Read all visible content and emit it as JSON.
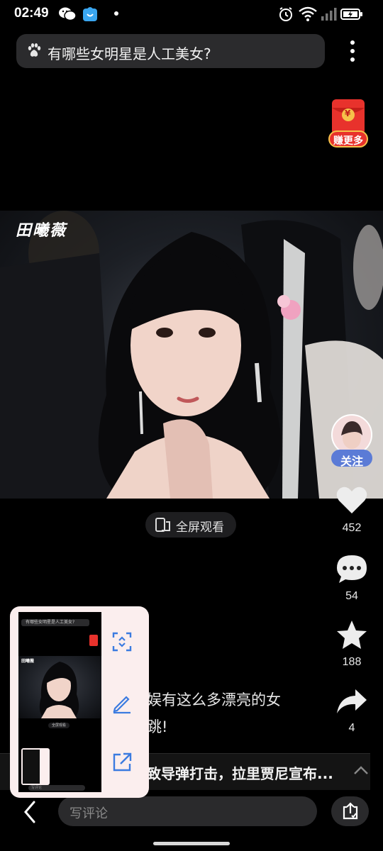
{
  "status_bar": {
    "time": "02:49",
    "icons": [
      "wechat-icon",
      "app-store-icon",
      "notification-dot",
      "alarm-icon",
      "wifi-icon",
      "signal-icon",
      "battery-icon"
    ]
  },
  "search": {
    "query": "有哪些女明星是人工美女?",
    "icon": "paw-icon"
  },
  "red_packet": {
    "label": "赚更多",
    "symbol": "¥"
  },
  "video": {
    "watermark": "田曦薇"
  },
  "fullscreen": {
    "label": "全屏观看"
  },
  "follow": {
    "label": "关注"
  },
  "actions": {
    "like_count": "452",
    "comment_count": "54",
    "favorite_count": "188",
    "share_count": "4"
  },
  "caption": {
    "line1": "娱有这么多漂亮的女",
    "line2": "跳!"
  },
  "news": {
    "headline": "致导弹打击，拉里贾尼宣布..."
  },
  "bottom": {
    "comment_placeholder": "写评论"
  },
  "thumbnail": {
    "search_text": "有哪些女明星是人工美女?",
    "watermark": "田曦薇",
    "fullscreen_label": "全屏观看",
    "comment_placeholder": "写评论"
  },
  "colors": {
    "accent_blue": "#3b7be0",
    "follow_bg": "#5b7bd6",
    "red_packet": "#e8322c",
    "panel_bg": "#fbeeee"
  }
}
